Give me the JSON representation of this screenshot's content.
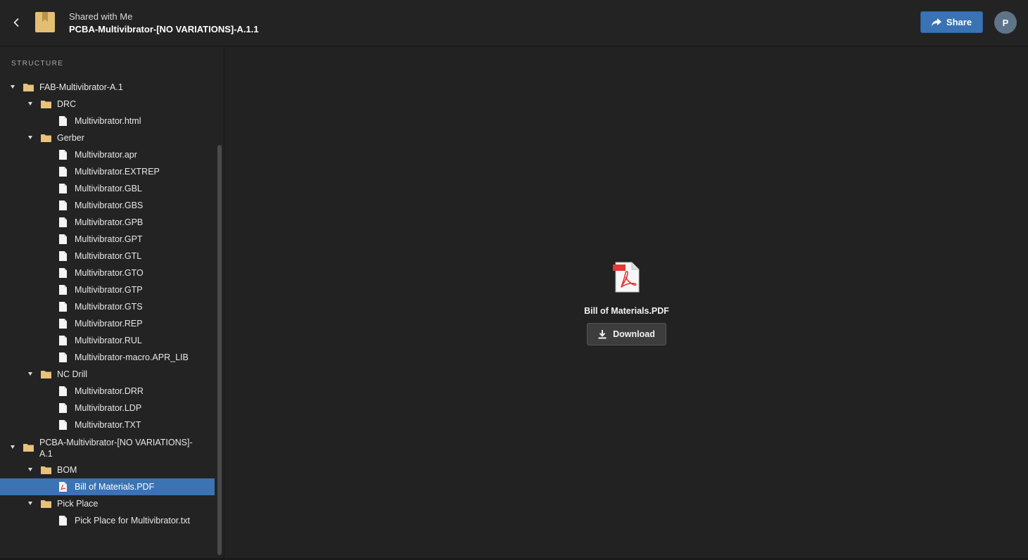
{
  "header": {
    "breadcrumb": "Shared with Me",
    "title": "PCBA-Multivibrator-[NO VARIATIONS]-A.1.1",
    "share_label": "Share",
    "avatar_initial": "P"
  },
  "sidebar": {
    "heading": "STRUCTURE",
    "items": [
      {
        "label": "FAB-Multivibrator-A.1",
        "type": "folder",
        "depth": 0
      },
      {
        "label": "DRC",
        "type": "folder",
        "depth": 1
      },
      {
        "label": "Multivibrator.html",
        "type": "file",
        "depth": 2
      },
      {
        "label": "Gerber",
        "type": "folder",
        "depth": 1
      },
      {
        "label": "Multivibrator.apr",
        "type": "file",
        "depth": 2
      },
      {
        "label": "Multivibrator.EXTREP",
        "type": "file",
        "depth": 2
      },
      {
        "label": "Multivibrator.GBL",
        "type": "file",
        "depth": 2
      },
      {
        "label": "Multivibrator.GBS",
        "type": "file",
        "depth": 2
      },
      {
        "label": "Multivibrator.GPB",
        "type": "file",
        "depth": 2
      },
      {
        "label": "Multivibrator.GPT",
        "type": "file",
        "depth": 2
      },
      {
        "label": "Multivibrator.GTL",
        "type": "file",
        "depth": 2
      },
      {
        "label": "Multivibrator.GTO",
        "type": "file",
        "depth": 2
      },
      {
        "label": "Multivibrator.GTP",
        "type": "file",
        "depth": 2
      },
      {
        "label": "Multivibrator.GTS",
        "type": "file",
        "depth": 2
      },
      {
        "label": "Multivibrator.REP",
        "type": "file",
        "depth": 2
      },
      {
        "label": "Multivibrator.RUL",
        "type": "file",
        "depth": 2
      },
      {
        "label": "Multivibrator-macro.APR_LIB",
        "type": "file",
        "depth": 2
      },
      {
        "label": "NC Drill",
        "type": "folder",
        "depth": 1
      },
      {
        "label": "Multivibrator.DRR",
        "type": "file",
        "depth": 2
      },
      {
        "label": "Multivibrator.LDP",
        "type": "file",
        "depth": 2
      },
      {
        "label": "Multivibrator.TXT",
        "type": "file",
        "depth": 2
      },
      {
        "label": "PCBA-Multivibrator-[NO VARIATIONS]-A.1",
        "type": "folder",
        "depth": 0
      },
      {
        "label": "BOM",
        "type": "folder",
        "depth": 1
      },
      {
        "label": "Bill of Materials.PDF",
        "type": "pdf",
        "depth": 2,
        "selected": true
      },
      {
        "label": "Pick Place",
        "type": "folder",
        "depth": 1
      },
      {
        "label": "Pick Place for Multivibrator.txt",
        "type": "file",
        "depth": 2
      }
    ]
  },
  "preview": {
    "file_name": "Bill of Materials.PDF",
    "download_label": "Download"
  },
  "colors": {
    "accent": "#3b73b3",
    "folder": "#e8c27a",
    "background": "#232323"
  },
  "icons": {
    "back": "chevron-left-icon",
    "app": "bookmark-folder-icon",
    "share": "share-arrow-icon",
    "download": "download-icon",
    "folder": "folder-icon",
    "file": "file-icon",
    "pdf": "pdf-file-icon"
  }
}
